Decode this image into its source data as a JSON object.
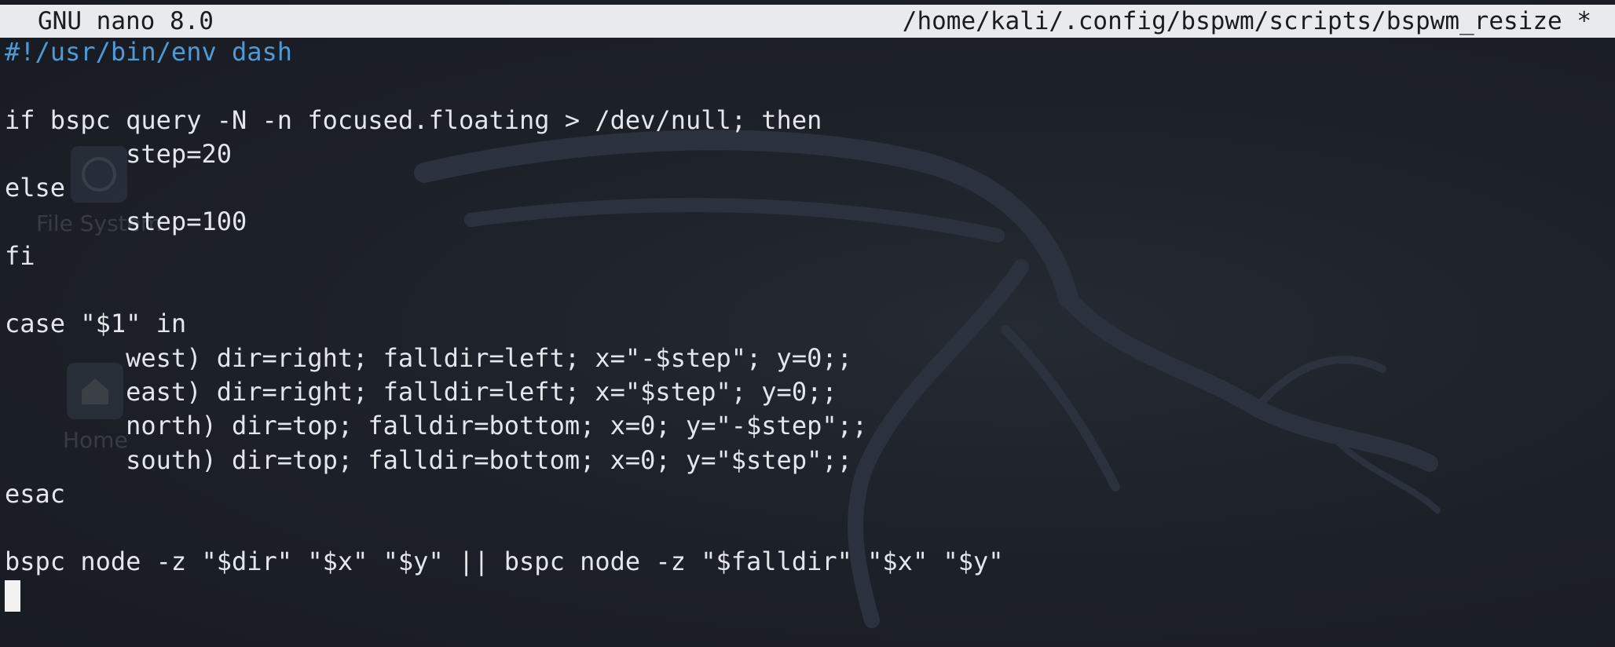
{
  "nano": {
    "version_label": "GNU nano 8.0",
    "file_path": "/home/kali/.config/bspwm/scripts/bspwm_resize *"
  },
  "editor": {
    "lines": [
      "#!/usr/bin/env dash",
      "",
      "if bspc query -N -n focused.floating > /dev/null; then",
      "        step=20",
      "else",
      "        step=100",
      "fi",
      "",
      "case \"$1\" in",
      "        west) dir=right; falldir=left; x=\"-$step\"; y=0;;",
      "        east) dir=right; falldir=left; x=\"$step\"; y=0;;",
      "        north) dir=top; falldir=bottom; x=0; y=\"-$step\";;",
      "        south) dir=top; falldir=bottom; x=0; y=\"$step\";;",
      "esac",
      "",
      "bspc node -z \"$dir\" \"$x\" \"$y\" || bspc node -z \"$falldir\" \"$x\" \"$y\"",
      ""
    ]
  },
  "desktop": {
    "icons": [
      {
        "label": "File System",
        "icon": "drive-icon"
      },
      {
        "label": "Home",
        "icon": "home-icon"
      }
    ]
  },
  "colors": {
    "background": "#1b1f27",
    "titlebar_bg": "#e8eaed",
    "comment": "#4f9ad6",
    "text": "#e3e6ea"
  }
}
